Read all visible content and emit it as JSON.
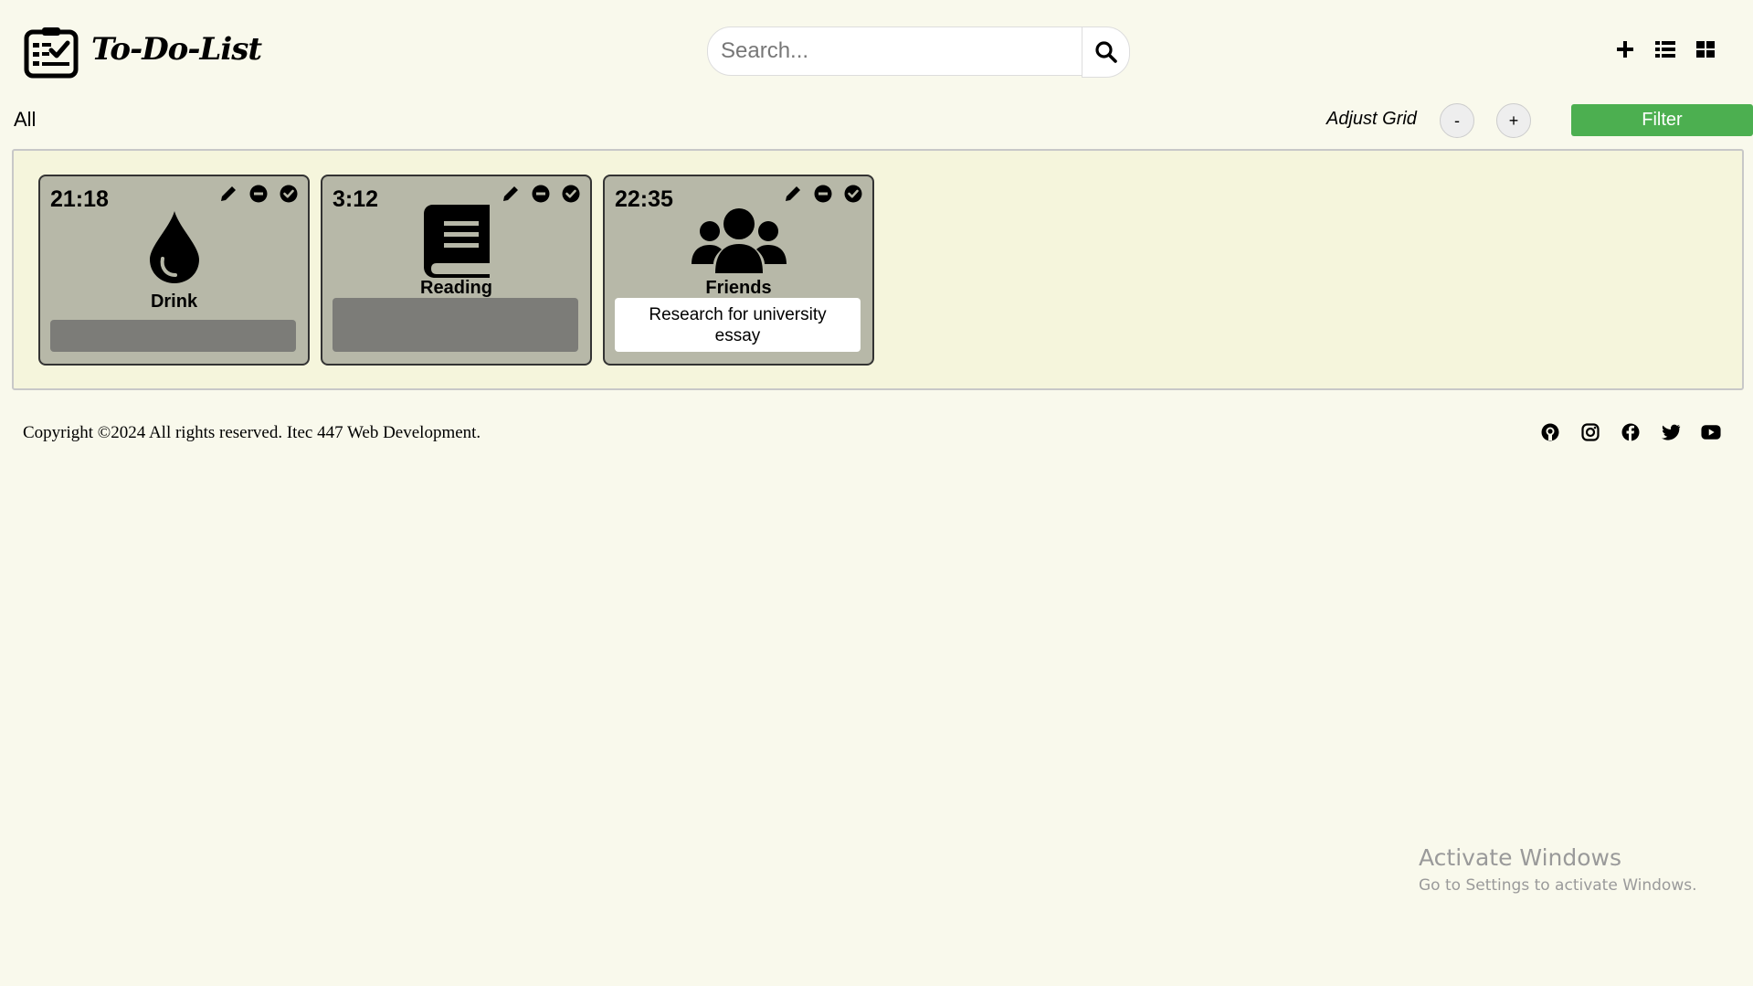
{
  "app": {
    "title": "To-Do-List"
  },
  "search": {
    "placeholder": "Search...",
    "value": ""
  },
  "toolbar": {
    "icons": [
      "plus-icon",
      "list-view-icon",
      "grid-view-icon"
    ]
  },
  "category": "All",
  "grid": {
    "label": "Adjust Grid",
    "minus": "-",
    "plus": "+"
  },
  "filter": {
    "label": "Filter",
    "color": "#4caf50"
  },
  "cards": [
    {
      "time": "21:18",
      "title": "Drink",
      "icon": "water-drop-icon",
      "note": ""
    },
    {
      "time": "3:12",
      "title": "Reading",
      "icon": "book-icon",
      "note": ""
    },
    {
      "time": "22:35",
      "title": "Friends",
      "icon": "users-icon",
      "note": "Research for university essay"
    }
  ],
  "footer": {
    "copyright": "Copyright ©2024 All rights reserved. Itec 447 Web Development.",
    "social": [
      "github-icon",
      "instagram-icon",
      "facebook-icon",
      "twitter-icon",
      "youtube-icon"
    ]
  },
  "watermark": {
    "title": "Activate Windows",
    "subtitle": "Go to Settings to activate Windows."
  },
  "colors": {
    "background": "#f9f9ec",
    "board": "#f5f5dc",
    "card": "#b7b8a8",
    "note_empty": "#7c7c78"
  }
}
